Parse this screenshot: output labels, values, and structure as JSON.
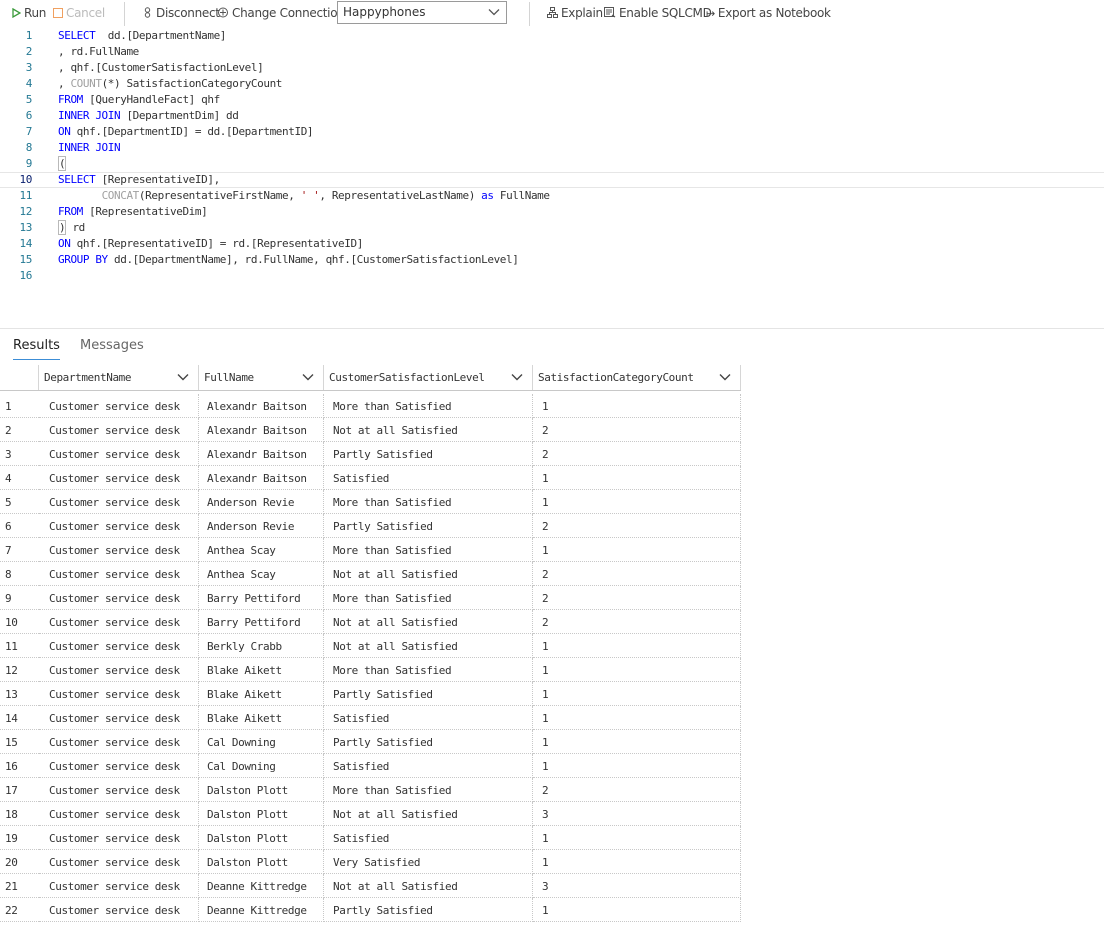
{
  "toolbar": {
    "run": "Run",
    "cancel": "Cancel",
    "disconnect": "Disconnect",
    "change_connection": "Change Connection",
    "database": "Happyphones",
    "explain": "Explain",
    "enable_sqlcmd": "Enable SQLCMD",
    "export_notebook": "Export as Notebook"
  },
  "editor": {
    "lines": [
      {
        "n": "1",
        "parts": [
          [
            "kw",
            "SELECT"
          ],
          [
            "",
            "  dd.[DepartmentName]"
          ]
        ]
      },
      {
        "n": "2",
        "parts": [
          [
            "",
            ", rd.FullName"
          ]
        ]
      },
      {
        "n": "3",
        "parts": [
          [
            "",
            ", qhf.[CustomerSatisfactionLevel]"
          ]
        ]
      },
      {
        "n": "4",
        "parts": [
          [
            "",
            ", "
          ],
          [
            "fnd",
            "COUNT"
          ],
          [
            "",
            "(*) SatisfactionCategoryCount"
          ]
        ]
      },
      {
        "n": "5",
        "parts": [
          [
            "kw",
            "FROM"
          ],
          [
            "",
            " [QueryHandleFact] qhf"
          ]
        ]
      },
      {
        "n": "6",
        "parts": [
          [
            "kw",
            "INNER JOIN"
          ],
          [
            "",
            " [DepartmentDim] dd"
          ]
        ]
      },
      {
        "n": "7",
        "parts": [
          [
            "kw",
            "ON"
          ],
          [
            "",
            " qhf.[DepartmentID] = dd.[DepartmentID]"
          ]
        ]
      },
      {
        "n": "8",
        "parts": [
          [
            "kw",
            "INNER JOIN"
          ]
        ]
      },
      {
        "n": "9",
        "parts": [
          [
            "bracket",
            "("
          ]
        ]
      },
      {
        "n": "10",
        "parts": [
          [
            "kw",
            "SELECT"
          ],
          [
            "",
            " [RepresentativeID],"
          ]
        ]
      },
      {
        "n": "11",
        "parts": [
          [
            "",
            "       "
          ],
          [
            "fnd",
            "CONCAT"
          ],
          [
            "",
            "(RepresentativeFirstName, "
          ],
          [
            "str",
            "' '"
          ],
          [
            "",
            ", RepresentativeLastName) "
          ],
          [
            "kw",
            "as"
          ],
          [
            "",
            " FullName"
          ]
        ]
      },
      {
        "n": "12",
        "parts": [
          [
            "kw",
            "FROM"
          ],
          [
            "",
            " [RepresentativeDim]"
          ]
        ]
      },
      {
        "n": "13",
        "parts": [
          [
            "bracket",
            ")"
          ],
          [
            "",
            " rd"
          ]
        ]
      },
      {
        "n": "14",
        "parts": [
          [
            "kw",
            "ON"
          ],
          [
            "",
            " qhf.[RepresentativeID] = rd.[RepresentativeID]"
          ]
        ]
      },
      {
        "n": "15",
        "parts": [
          [
            "kw",
            "GROUP BY"
          ],
          [
            "",
            " dd.[DepartmentName], rd.FullName, qhf.[CustomerSatisfactionLevel]"
          ]
        ]
      },
      {
        "n": "16",
        "parts": []
      }
    ]
  },
  "results": {
    "tabs": [
      "Results",
      "Messages"
    ],
    "columns": [
      "DepartmentName",
      "FullName",
      "CustomerSatisfactionLevel",
      "SatisfactionCategoryCount"
    ],
    "rows": [
      [
        "1",
        "Customer service desk",
        "Alexandr Baitson",
        "More than Satisfied",
        "1"
      ],
      [
        "2",
        "Customer service desk",
        "Alexandr Baitson",
        "Not at all Satisfied",
        "2"
      ],
      [
        "3",
        "Customer service desk",
        "Alexandr Baitson",
        "Partly Satisfied",
        "2"
      ],
      [
        "4",
        "Customer service desk",
        "Alexandr Baitson",
        "Satisfied",
        "1"
      ],
      [
        "5",
        "Customer service desk",
        "Anderson Revie",
        "More than Satisfied",
        "1"
      ],
      [
        "6",
        "Customer service desk",
        "Anderson Revie",
        "Partly Satisfied",
        "2"
      ],
      [
        "7",
        "Customer service desk",
        "Anthea Scay",
        "More than Satisfied",
        "1"
      ],
      [
        "8",
        "Customer service desk",
        "Anthea Scay",
        "Not at all Satisfied",
        "2"
      ],
      [
        "9",
        "Customer service desk",
        "Barry Pettiford",
        "More than Satisfied",
        "2"
      ],
      [
        "10",
        "Customer service desk",
        "Barry Pettiford",
        "Not at all Satisfied",
        "2"
      ],
      [
        "11",
        "Customer service desk",
        "Berkly Crabb",
        "Not at all Satisfied",
        "1"
      ],
      [
        "12",
        "Customer service desk",
        "Blake Aikett",
        "More than Satisfied",
        "1"
      ],
      [
        "13",
        "Customer service desk",
        "Blake Aikett",
        "Partly Satisfied",
        "1"
      ],
      [
        "14",
        "Customer service desk",
        "Blake Aikett",
        "Satisfied",
        "1"
      ],
      [
        "15",
        "Customer service desk",
        "Cal Downing",
        "Partly Satisfied",
        "1"
      ],
      [
        "16",
        "Customer service desk",
        "Cal Downing",
        "Satisfied",
        "1"
      ],
      [
        "17",
        "Customer service desk",
        "Dalston Plott",
        "More than Satisfied",
        "2"
      ],
      [
        "18",
        "Customer service desk",
        "Dalston Plott",
        "Not at all Satisfied",
        "3"
      ],
      [
        "19",
        "Customer service desk",
        "Dalston Plott",
        "Satisfied",
        "1"
      ],
      [
        "20",
        "Customer service desk",
        "Dalston Plott",
        "Very Satisfied",
        "1"
      ],
      [
        "21",
        "Customer service desk",
        "Deanne Kittredge",
        "Not at all Satisfied",
        "3"
      ],
      [
        "22",
        "Customer service desk",
        "Deanne Kittredge",
        "Partly Satisfied",
        "1"
      ]
    ]
  }
}
